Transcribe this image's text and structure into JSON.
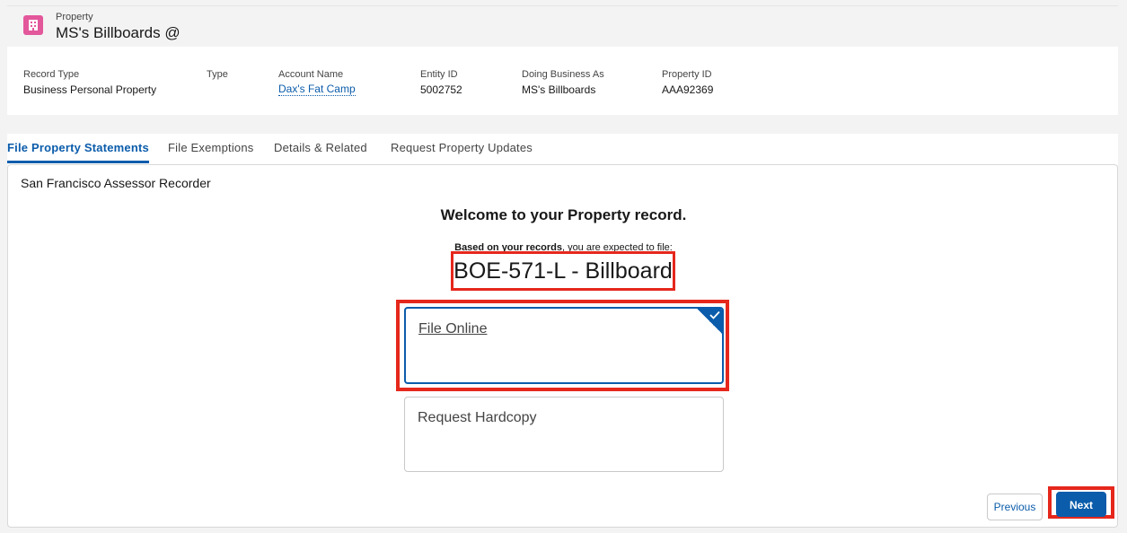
{
  "header": {
    "object_type": "Property",
    "record_name": "MS's Billboards @"
  },
  "highlights": {
    "fields": [
      {
        "label": "Record Type",
        "value": "Business Personal Property"
      },
      {
        "label": "Type",
        "value": ""
      },
      {
        "label": "Account Name",
        "value": "Dax's Fat Camp"
      },
      {
        "label": "Entity ID",
        "value": "5002752"
      },
      {
        "label": "Doing Business As",
        "value": "MS's Billboards"
      },
      {
        "label": "Property ID",
        "value": "AAA92369"
      }
    ]
  },
  "tabs": [
    {
      "label": "File Property Statements",
      "active": true
    },
    {
      "label": "File Exemptions",
      "active": false
    },
    {
      "label": "Details & Related",
      "active": false
    },
    {
      "label": "Request Property Updates",
      "active": false
    }
  ],
  "panel": {
    "org": "San Francisco Assessor Recorder",
    "welcome": "Welcome to your Property record.",
    "based_bold": "Based on your records",
    "based_rest": ", you are expected to file:",
    "form_name": "BOE-571-L - Billboard",
    "options": [
      {
        "label": "File Online",
        "selected": true
      },
      {
        "label": "Request Hardcopy",
        "selected": false
      }
    ],
    "previous_label": "Previous",
    "next_label": "Next"
  },
  "colors": {
    "brand": "#0b5cab",
    "highlight_red": "#e6271c",
    "object_icon": "#e3579b"
  },
  "icons": {
    "object": "building-icon",
    "selected": "checkmark-icon"
  }
}
